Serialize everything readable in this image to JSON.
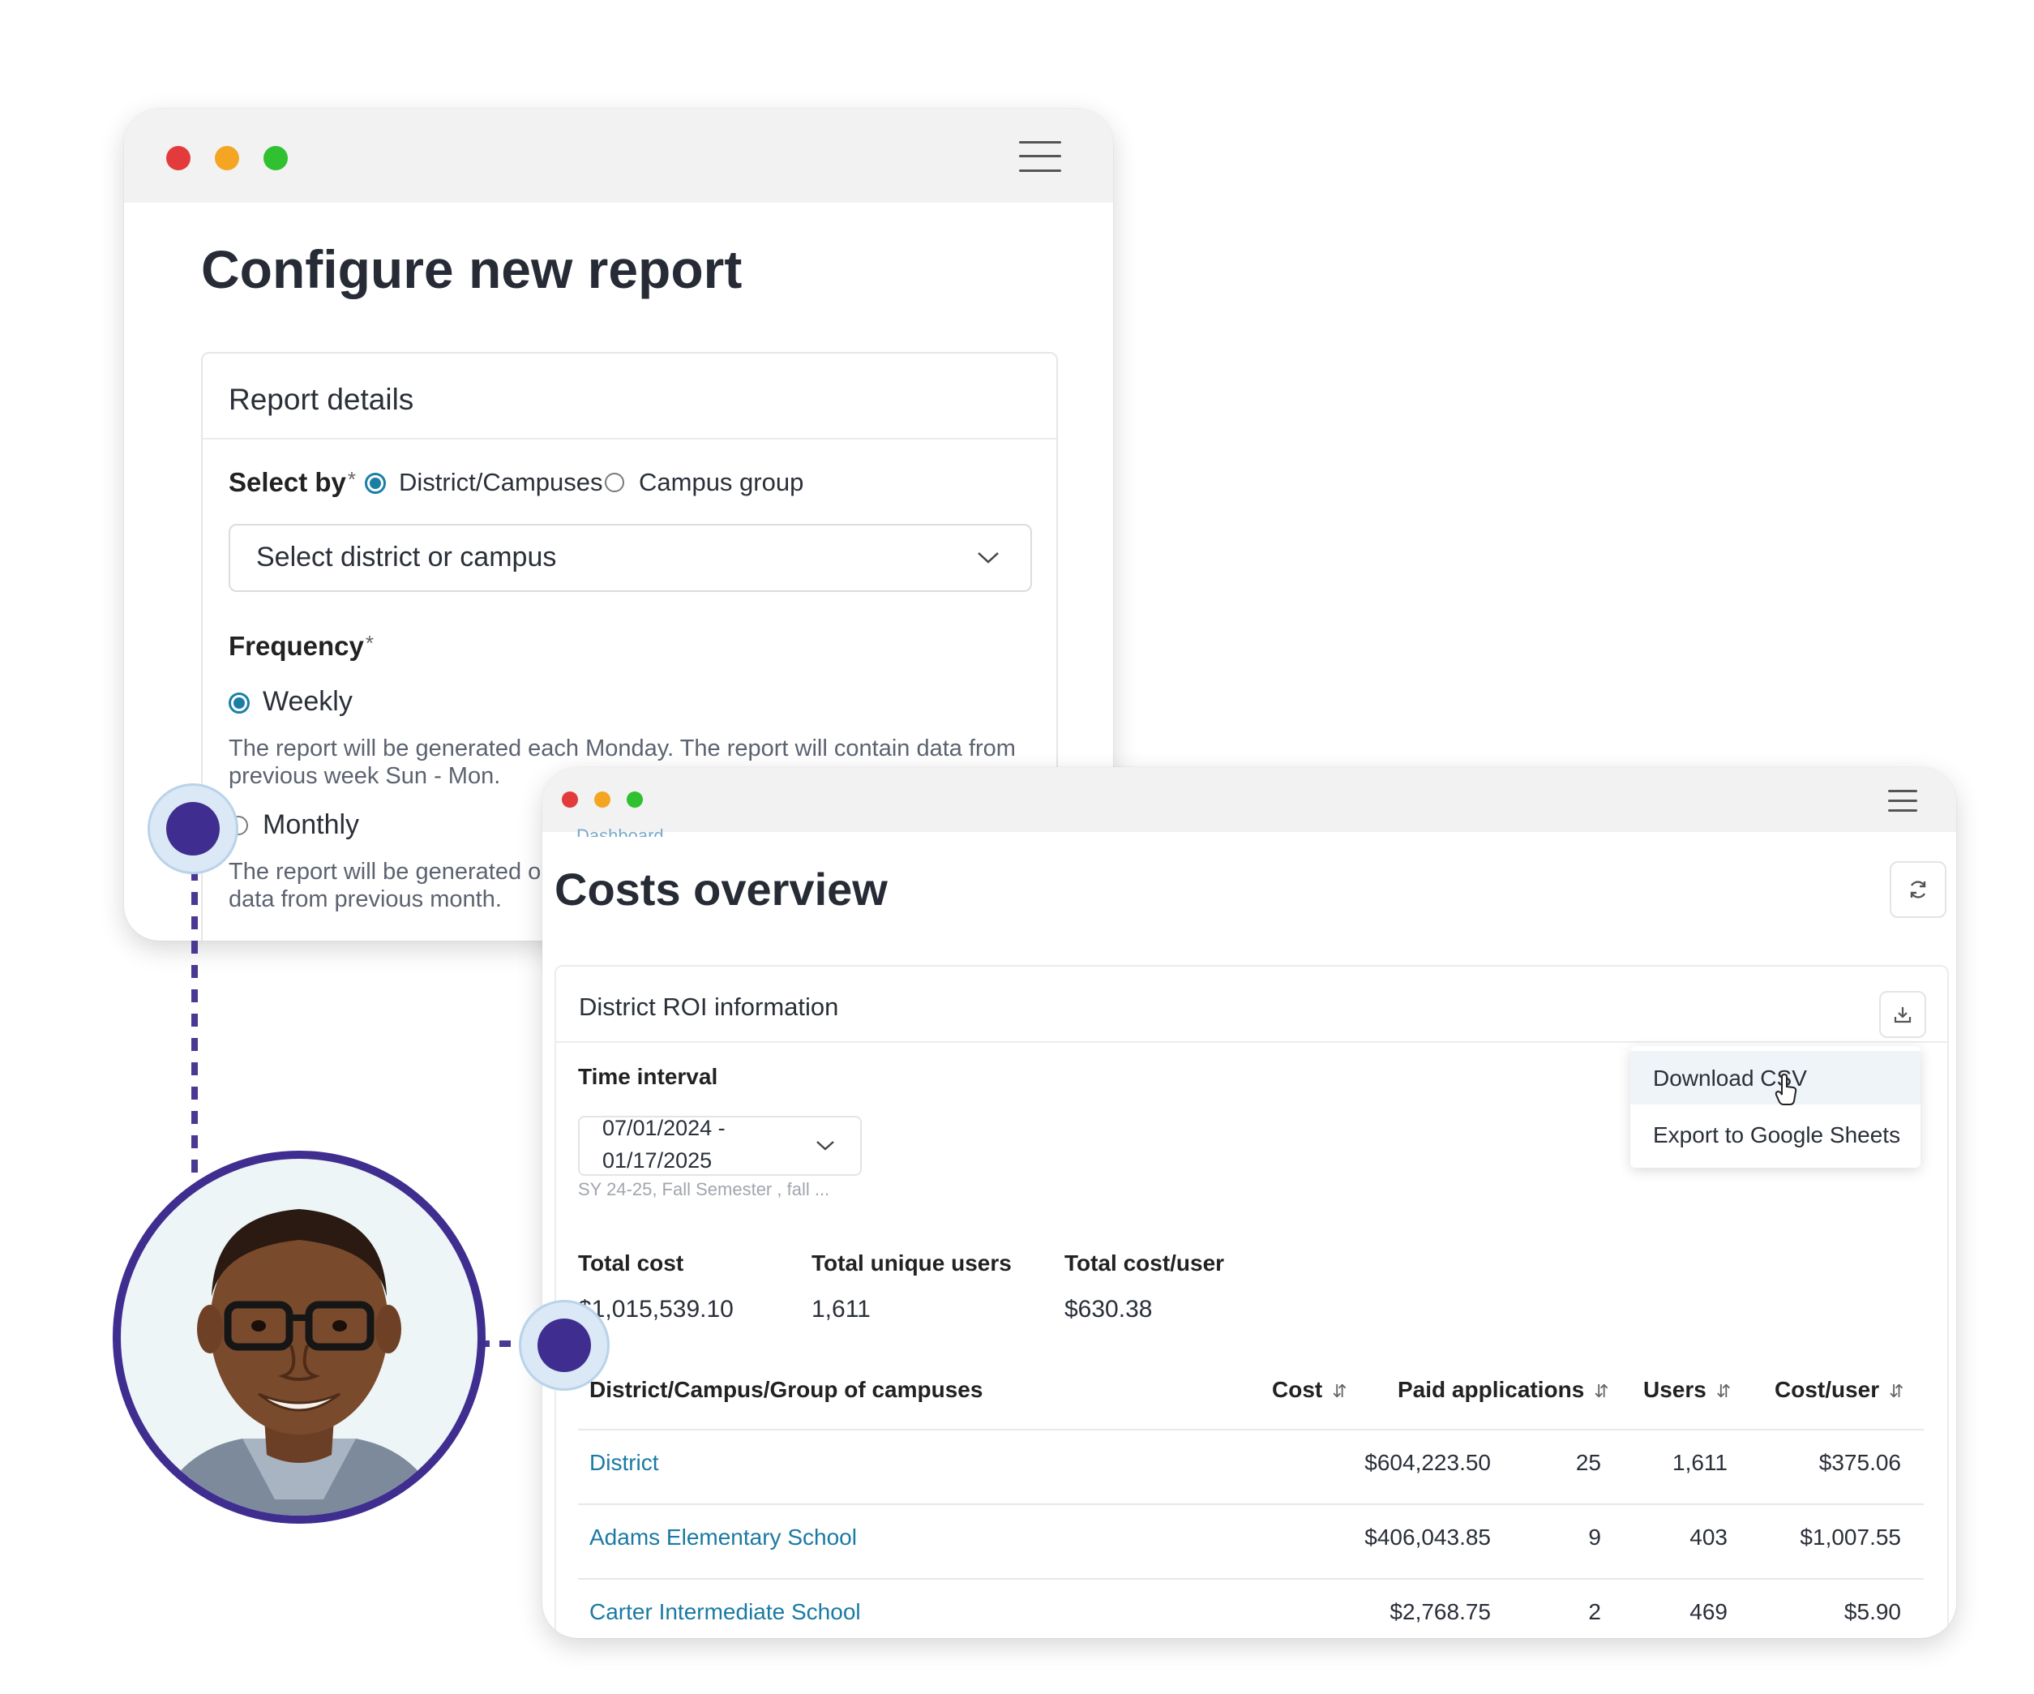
{
  "window1": {
    "title": "Configure new report",
    "card_title": "Report details",
    "select_by_label": "Select by",
    "required_mark": "*",
    "radio_district": "District/Campuses",
    "radio_group": "Campus group",
    "select_placeholder": "Select district or campus",
    "frequency_label": "Frequency",
    "weekly_label": "Weekly",
    "weekly_desc_1": "The report will be generated each Monday. The report will contain data from",
    "weekly_desc_2": "previous week Sun - Mon.",
    "monthly_label": "Monthly",
    "monthly_desc_1": "The report will be generated on",
    "monthly_desc_2": "data from previous month."
  },
  "window2": {
    "breadcrumb": "Dashboard",
    "title": "Costs overview",
    "card_title": "District ROI information",
    "time_interval_label": "Time interval",
    "date_range_line1": "07/01/2024 -",
    "date_range_line2": "01/17/2025",
    "date_hint": "SY 24-25, Fall Semester , fall ...",
    "menu": {
      "download_csv": "Download CSV",
      "export_sheets": "Export to Google Sheets"
    },
    "stats": {
      "total_cost_label": "Total cost",
      "total_cost_value": "$1,015,539.10",
      "unique_users_label": "Total unique users",
      "unique_users_value": "1,611",
      "cost_per_user_label": "Total cost/user",
      "cost_per_user_value": "$630.38"
    },
    "table": {
      "columns": [
        "District/Campus/Group of campuses",
        "Cost",
        "Paid applications",
        "Users",
        "Cost/user"
      ],
      "rows": [
        [
          "District",
          "$604,223.50",
          "25",
          "1,611",
          "$375.06"
        ],
        [
          "Adams Elementary School",
          "$406,043.85",
          "9",
          "403",
          "$1,007.55"
        ],
        [
          "Carter Intermediate School",
          "$2,768.75",
          "2",
          "469",
          "$5.90"
        ]
      ]
    }
  },
  "colors": {
    "traffic_red": "#e33b3b",
    "traffic_yellow": "#f4a623",
    "traffic_green": "#2fc12f",
    "accent_blue": "#1b7fa5",
    "link_blue": "#1a7aa3",
    "connector_purple": "#3f2e8f"
  },
  "icons": [
    "hamburger-menu-icon",
    "refresh-icon",
    "download-icon",
    "chevron-down-icon",
    "sort-icon",
    "cursor-hand-icon"
  ]
}
